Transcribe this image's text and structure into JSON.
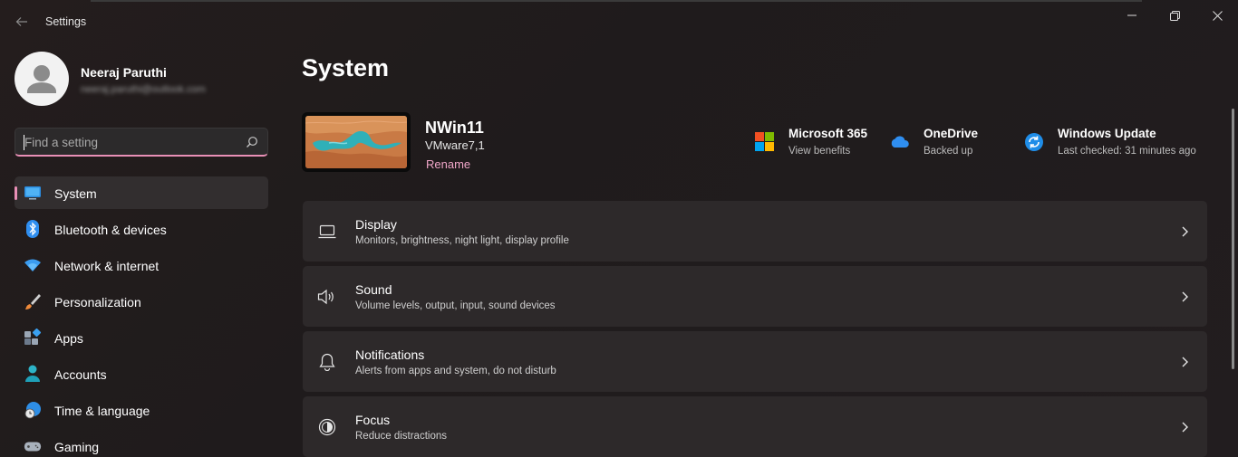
{
  "window": {
    "app_title": "Settings"
  },
  "profile": {
    "name": "Neeraj Paruthi",
    "email": "neeraj.paruthi@outlook.com"
  },
  "search": {
    "placeholder": "Find a setting"
  },
  "sidebar": {
    "items": [
      {
        "label": "System",
        "icon": "system-monitor-icon",
        "active": true
      },
      {
        "label": "Bluetooth & devices",
        "icon": "bluetooth-icon"
      },
      {
        "label": "Network & internet",
        "icon": "wifi-icon"
      },
      {
        "label": "Personalization",
        "icon": "paintbrush-icon"
      },
      {
        "label": "Apps",
        "icon": "apps-icon"
      },
      {
        "label": "Accounts",
        "icon": "account-icon"
      },
      {
        "label": "Time & language",
        "icon": "globe-clock-icon"
      },
      {
        "label": "Gaming",
        "icon": "gamepad-icon"
      }
    ]
  },
  "main": {
    "title": "System",
    "device": {
      "name": "NWin11",
      "model": "VMware7,1",
      "rename_label": "Rename"
    },
    "quick_links": [
      {
        "title": "Microsoft 365",
        "subtitle": "View benefits",
        "icon": "microsoft-logo-icon"
      },
      {
        "title": "OneDrive",
        "subtitle": "Backed up",
        "icon": "onedrive-cloud-icon"
      },
      {
        "title": "Windows Update",
        "subtitle": "Last checked: 31 minutes ago",
        "icon": "windows-update-icon"
      }
    ],
    "settings": [
      {
        "title": "Display",
        "subtitle": "Monitors, brightness, night light, display profile",
        "icon": "laptop-icon"
      },
      {
        "title": "Sound",
        "subtitle": "Volume levels, output, input, sound devices",
        "icon": "speaker-icon"
      },
      {
        "title": "Notifications",
        "subtitle": "Alerts from apps and system, do not disturb",
        "icon": "bell-icon"
      },
      {
        "title": "Focus",
        "subtitle": "Reduce distractions",
        "icon": "focus-icon"
      }
    ]
  },
  "colors": {
    "accent": "#e98fb6",
    "link": "#f0a6c8",
    "background": "#211c1d",
    "card": "#2d292a"
  }
}
